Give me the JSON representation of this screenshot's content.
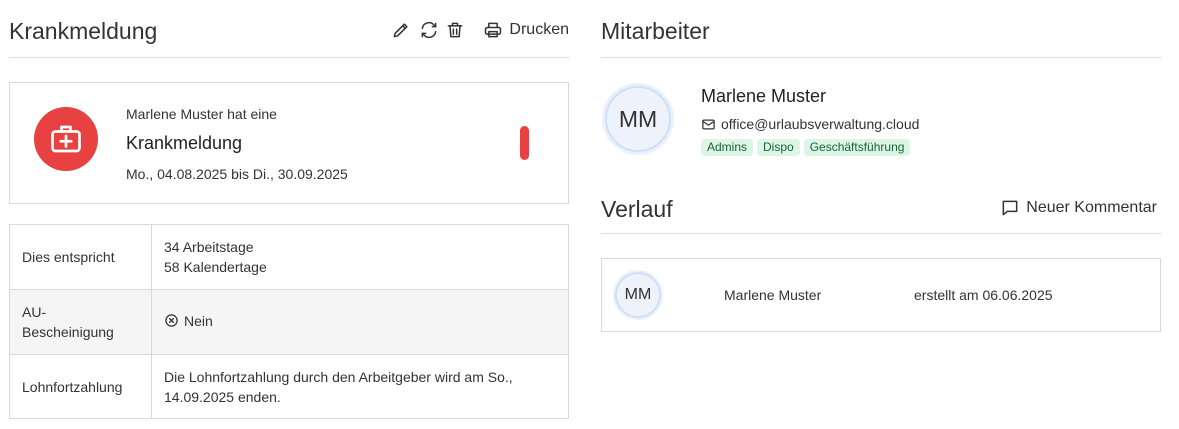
{
  "left": {
    "title": "Krankmeldung",
    "toolbar": {
      "edit_icon": "pencil-icon",
      "refresh_icon": "refresh-icon",
      "delete_icon": "trash-icon",
      "print_icon": "printer-icon",
      "print_label": "Drucken"
    },
    "card": {
      "icon": "medical-bag-icon",
      "accent_color": "#e84141",
      "line1": "Marlene Muster hat eine",
      "type": "Krankmeldung",
      "dates": "Mo., 04.08.2025 bis Di., 30.09.2025"
    },
    "table": {
      "equivalent_label": "Dies entspricht",
      "work_days": "34 Arbeitstage",
      "calendar_days": "58 Kalendertage",
      "au_label_1": "AU-",
      "au_label_2": "Bescheinigung",
      "au_value": "Nein",
      "au_icon": "circle-x-icon",
      "pay_label": "Lohnfortzahlung",
      "pay_text_1": "Die Lohnfortzahlung durch den Arbeitgeber wird am So.,",
      "pay_text_2": "14.09.2025 enden."
    }
  },
  "right": {
    "title": "Mitarbeiter",
    "employee": {
      "initials": "MM",
      "name": "Marlene Muster",
      "email_icon": "mail-icon",
      "email": "office@urlaubsverwaltung.cloud",
      "tags": [
        "Admins",
        "Dispo",
        "Geschäftsführung"
      ]
    },
    "history": {
      "title": "Verlauf",
      "comment_icon": "speech-bubble-icon",
      "comment_label": "Neuer Kommentar",
      "entries": [
        {
          "initials": "MM",
          "name": "Marlene Muster",
          "action": "erstellt am 06.06.2025"
        }
      ]
    }
  }
}
